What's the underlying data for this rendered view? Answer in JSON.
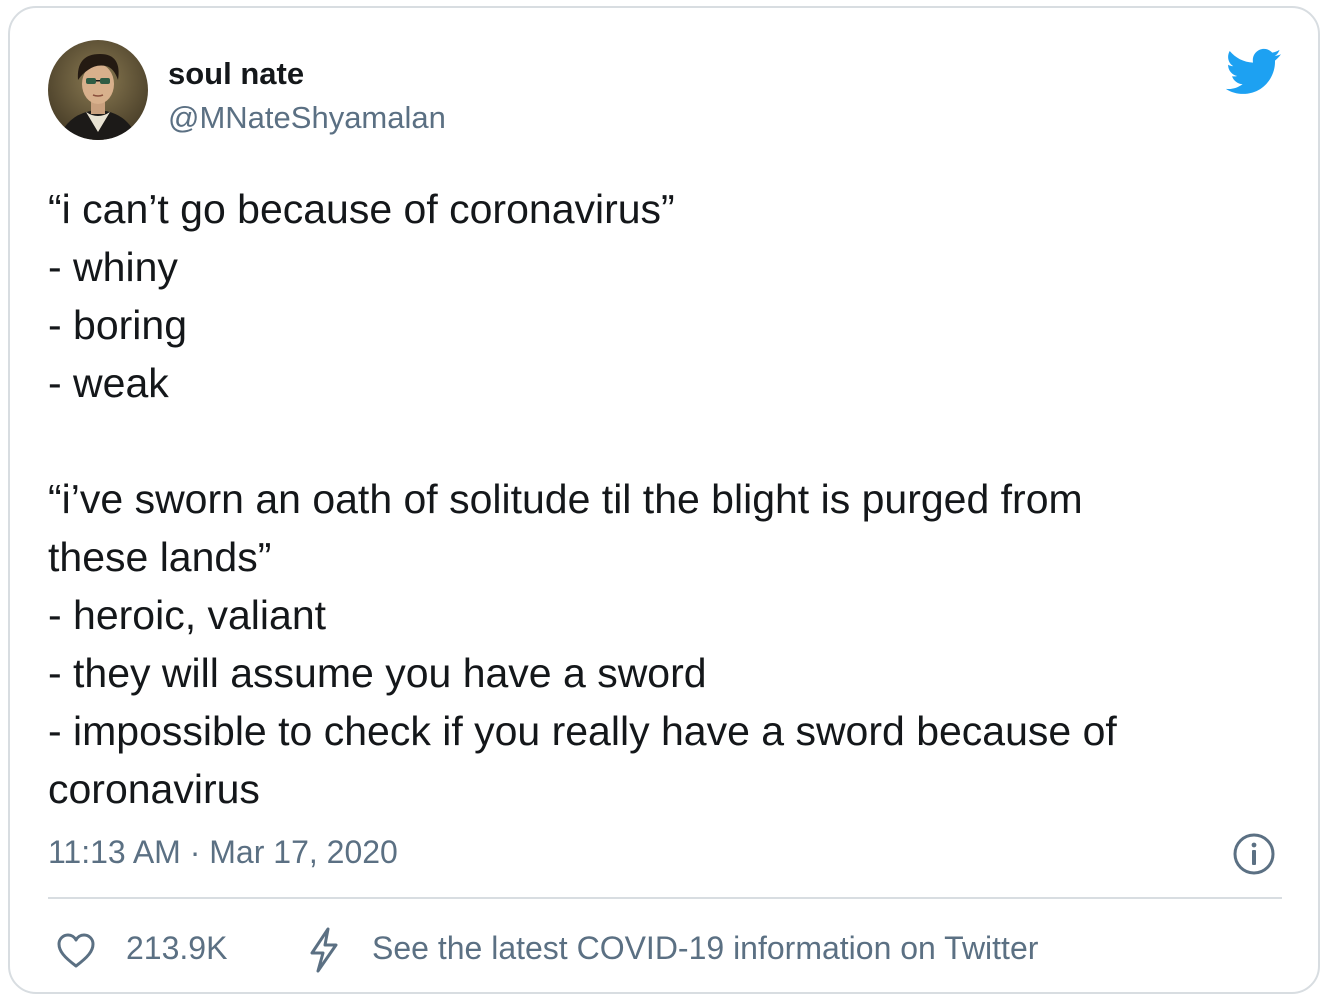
{
  "author": {
    "display_name": "soul nate",
    "handle": "@MNateShyamalan"
  },
  "tweet": {
    "lines": [
      "“i can’t go because of coronavirus”",
      "- whiny",
      "- boring",
      "- weak",
      "",
      "“i’ve sworn an oath of solitude til the blight is purged from",
      "these lands”",
      "- heroic, valiant",
      "- they will assume you have a sword",
      "- impossible to check if you really have a sword because of",
      "coronavirus"
    ],
    "timestamp": "11:13 AM · Mar 17, 2020"
  },
  "actions": {
    "like_count": "213.9K",
    "covid_link": "See the latest COVID-19 information on Twitter"
  },
  "icons": {
    "brand": "twitter-bird-icon",
    "info": "info-icon",
    "like": "heart-icon",
    "covid": "lightning-bolt-icon"
  },
  "colors": {
    "twitter_blue": "#1da1f2",
    "secondary_text": "#5b7083",
    "border": "#d8dde1"
  }
}
